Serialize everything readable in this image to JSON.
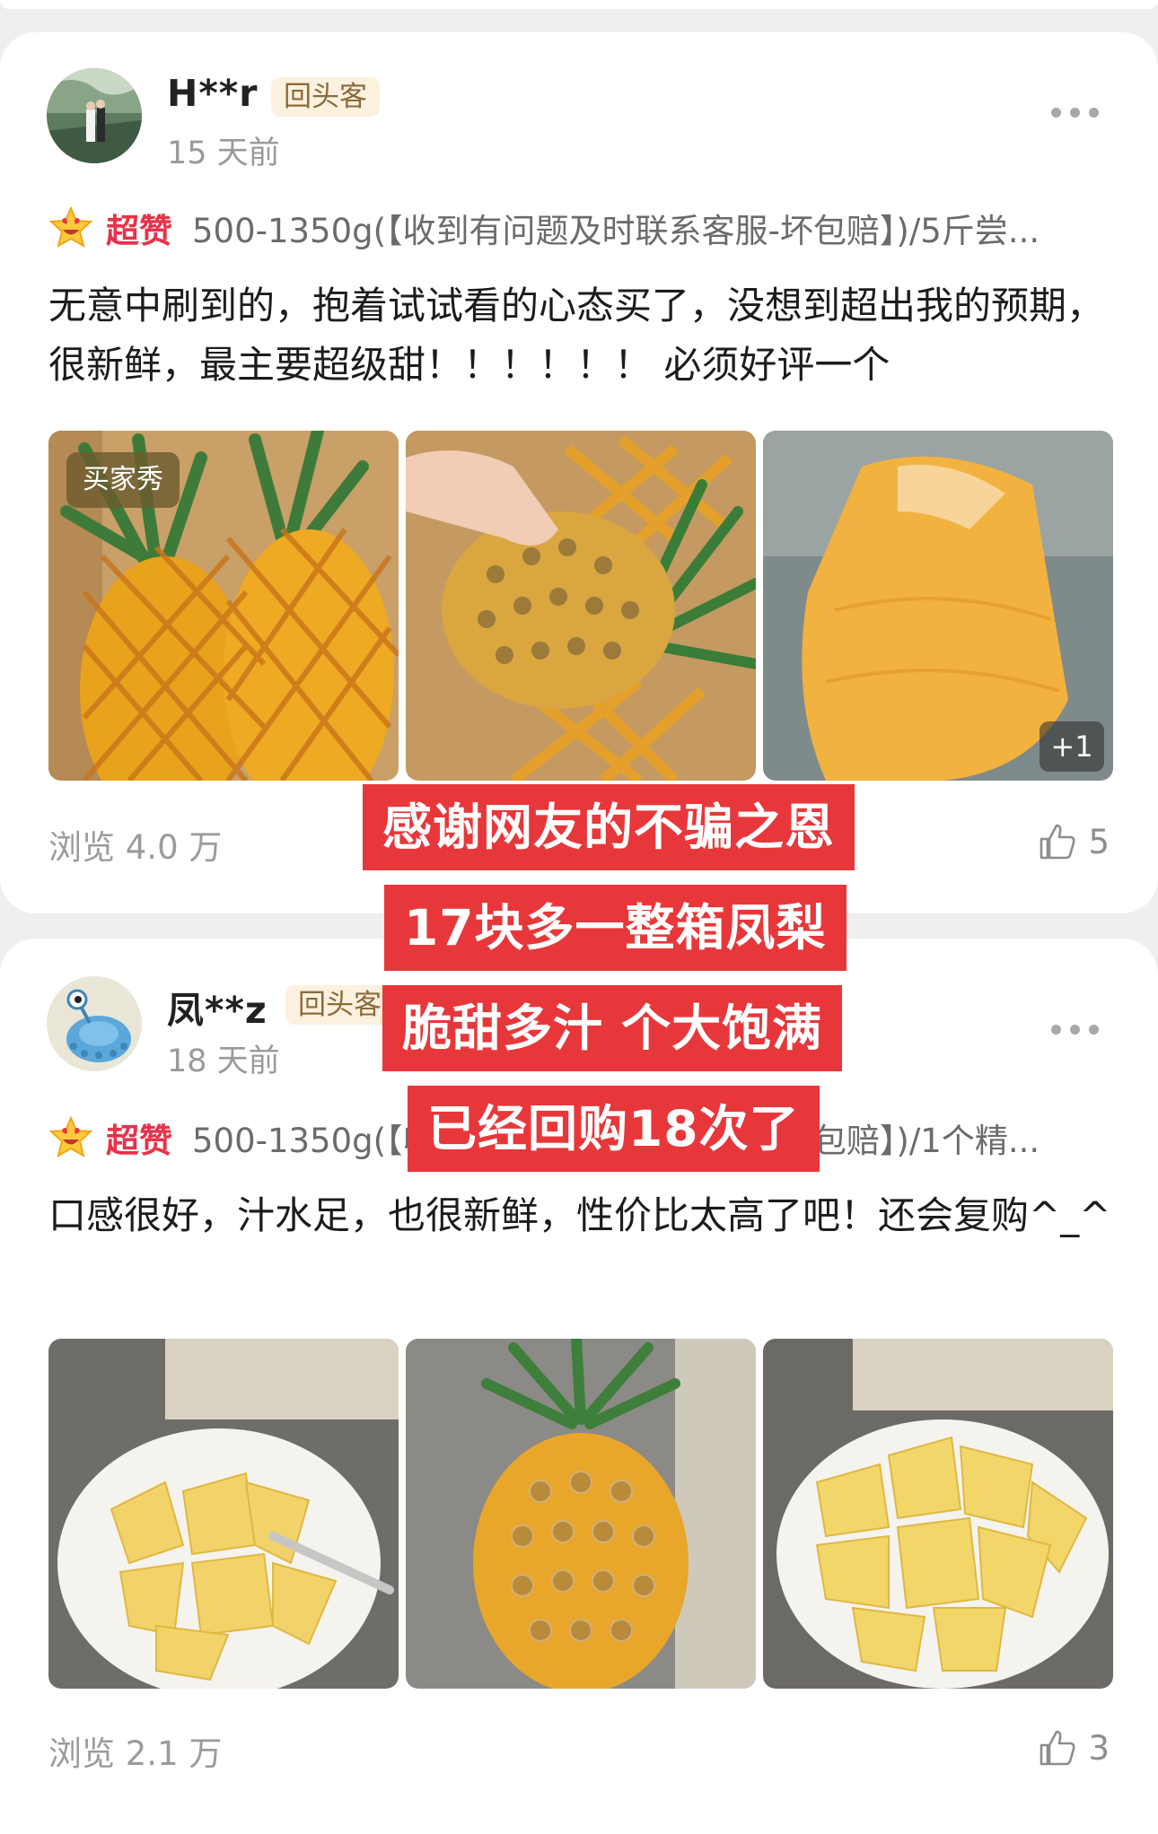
{
  "reviews": [
    {
      "username": "H**r",
      "badge": "回头客",
      "time": "15 天前",
      "rating_label": "超赞",
      "sku": "500-1350g(【收到有问题及时联系客服-坏包赔】)/5斤尝...",
      "text": "无意中刷到的，抱着试试看的心态买了，没想到超出我的预期，很新鲜，最主要超级甜！！！！！！ 必须好评一个",
      "photo_tag": "买家秀",
      "more_photos": "+1",
      "views": "浏览 4.0 万",
      "likes": "5",
      "photos": [
        "pineapples-in-foam-net",
        "hand-holding-pineapple",
        "peeled-pineapple"
      ]
    },
    {
      "username": "凤**z",
      "badge": "回头客",
      "time": "18 天前",
      "rating_label": "超赞",
      "sku": "500-1350g(【收到有问题及时联系客服-坏包赔】)/1个精...",
      "text": "口感很好，汁水足，也很新鲜，性价比太高了吧！还会复购^_^",
      "views": "浏览 2.1 万",
      "likes": "3",
      "photos": [
        "pineapple-chunks-plate-fork",
        "whole-pineapple",
        "pineapple-chunks-plate"
      ]
    }
  ],
  "overlay_captions": [
    "感谢网友的不骗之恩",
    "17块多一整箱凤梨",
    "脆甜多汁 个大饱满",
    "已经回购18次了"
  ],
  "colors": {
    "accent_red": "#e8373a",
    "rating_red": "#e8324a",
    "badge_bg": "#fbf1de"
  },
  "icons": [
    "more-icon",
    "star-face-icon",
    "thumb-up-icon"
  ]
}
